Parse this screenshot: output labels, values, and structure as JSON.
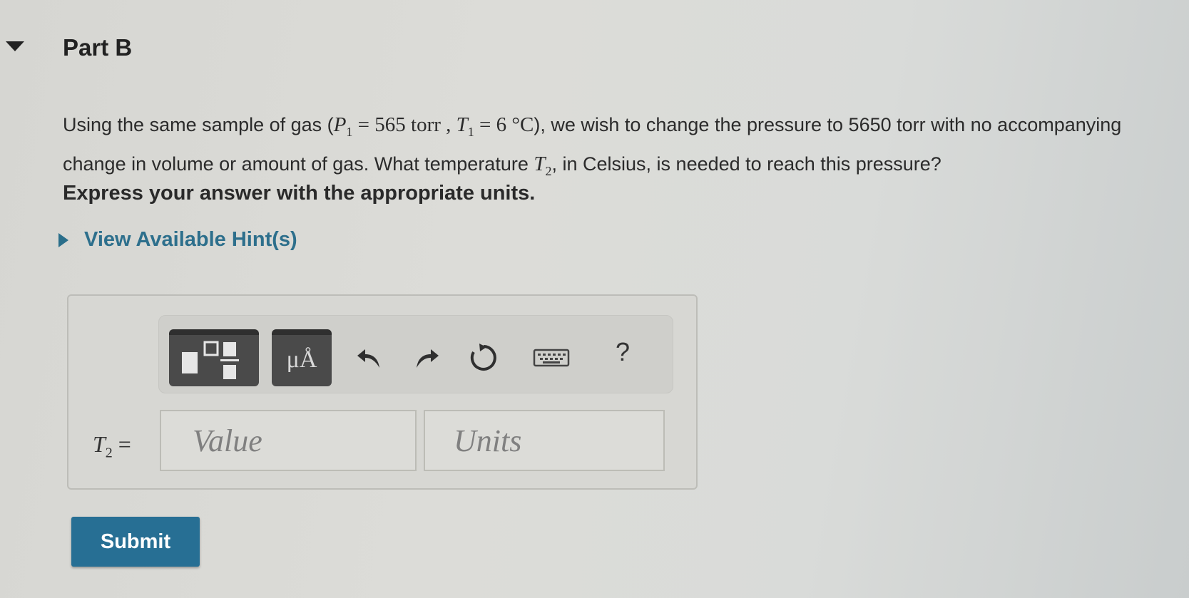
{
  "part": {
    "title": "Part B"
  },
  "question": {
    "text_1": "Using the same sample of gas (",
    "p_sym": "P",
    "p_sub": "1",
    "eq_1": " = 565 torr , ",
    "t_sym": "T",
    "t_sub": "1",
    "eq_2": " = 6 °C",
    "text_2": "), we wish to change the pressure to 5650 torr with no accompanying change in volume or amount of gas. What temperature ",
    "t2_sym": "T",
    "t2_sub": "2",
    "text_3": ", in Celsius, is needed to reach this pressure?"
  },
  "instruction": "Express your answer with the appropriate units.",
  "hints": {
    "label": "View Available Hint(s)"
  },
  "toolbar": {
    "templates_icon": "fraction-templates-icon",
    "units_label": "μÅ",
    "undo_icon": "undo-arrow-icon",
    "redo_icon": "redo-arrow-icon",
    "reset_icon": "reset-icon",
    "keyboard_icon": "keyboard-icon",
    "help_label": "?"
  },
  "answer": {
    "var_sym": "T",
    "var_sub": "2",
    "equals": " =",
    "value_placeholder": "Value",
    "units_placeholder": "Units"
  },
  "submit": {
    "label": "Submit"
  },
  "colors": {
    "accent": "#276f94",
    "hint": "#2d6f8c"
  }
}
